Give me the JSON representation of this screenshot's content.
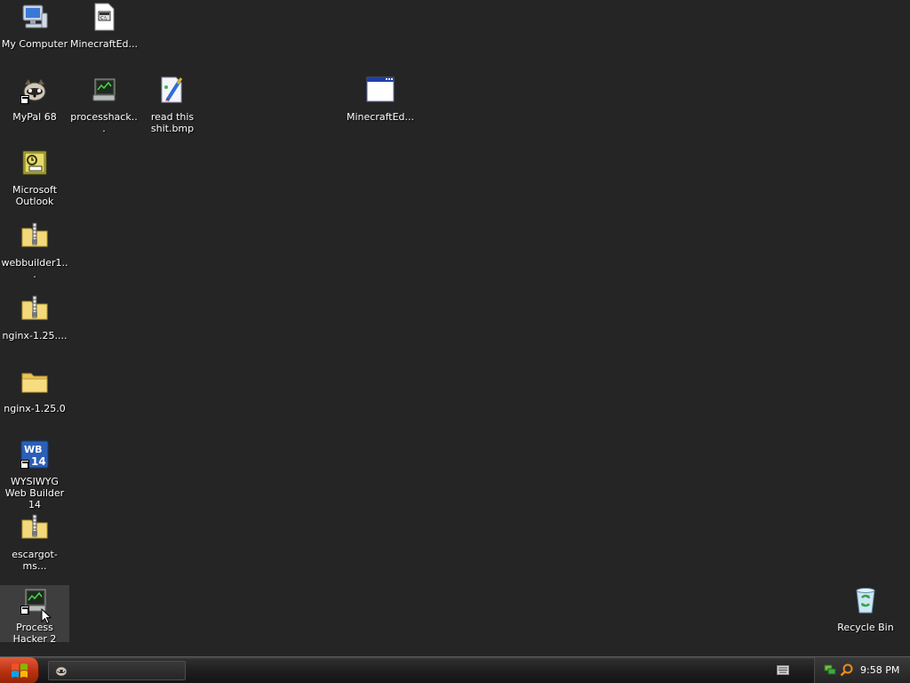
{
  "desktop": {
    "icons": {
      "my_computer": "My Computer",
      "minecraft_ed_1": "MinecraftEd...",
      "mypal": "MyPal 68",
      "processhack": "processhack...",
      "read_this": "read this shit.bmp",
      "minecraft_ed_2": "MinecraftEd...",
      "outlook": "Microsoft Outlook",
      "webbuilder_zip": "webbuilder1...",
      "nginx_zip": "nginx-1.25....",
      "nginx_folder": "nginx-1.25.0",
      "wysiwyg": "WYSIWYG Web Builder 14",
      "escargot": "escargot-ms...",
      "process_hacker": "Process Hacker 2",
      "recycle_bin": "Recycle Bin"
    }
  },
  "taskbar": {
    "clock": "9:58 PM"
  },
  "colors": {
    "wallpaper": "#252525",
    "start_button": "#c23a17"
  }
}
